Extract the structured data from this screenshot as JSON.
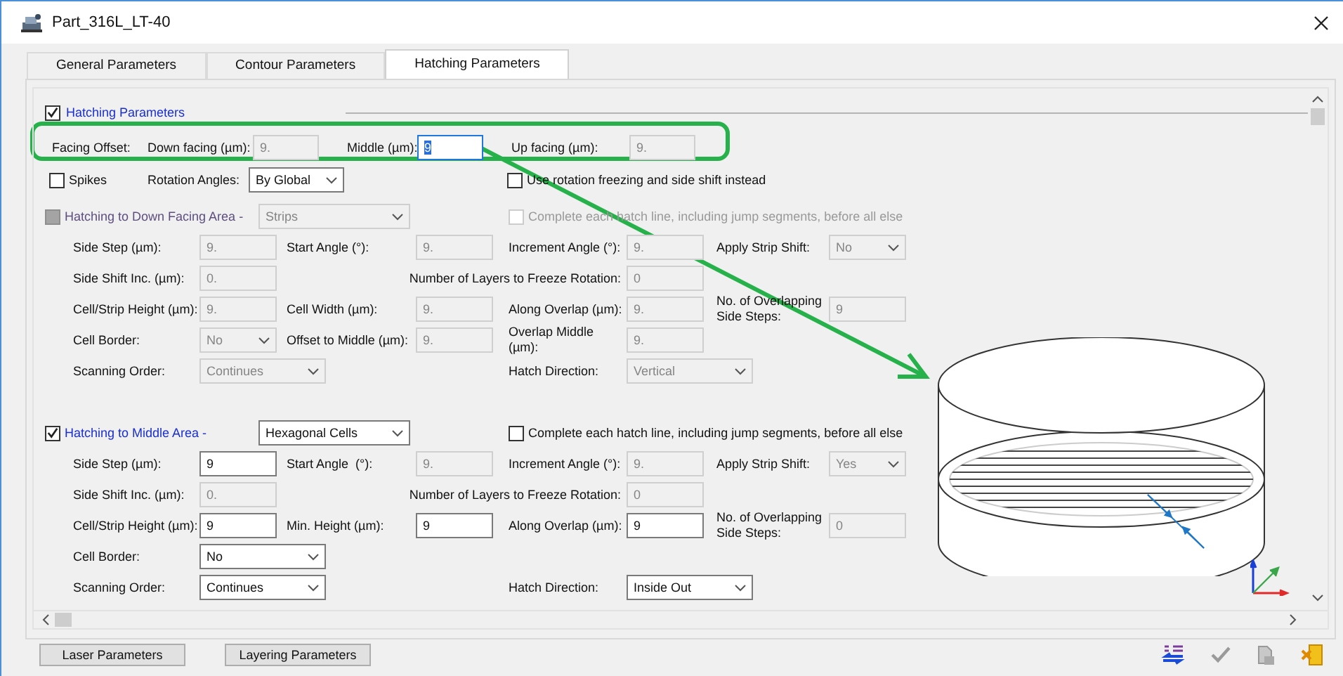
{
  "window": {
    "title": "Part_316L_LT-40"
  },
  "tabs": [
    {
      "label": "General Parameters",
      "selected": false
    },
    {
      "label": "Contour Parameters",
      "selected": false
    },
    {
      "label": "Hatching Parameters",
      "selected": true
    }
  ],
  "hatching_parameters": {
    "label": "Hatching Parameters",
    "checked": true
  },
  "facing_offset": {
    "label": "Facing Offset:",
    "fields": [
      {
        "label": "Down facing (µm):",
        "value": "9.",
        "disabled": true,
        "focused": false
      },
      {
        "label": "Middle (µm):",
        "value": "9",
        "disabled": false,
        "focused": true
      },
      {
        "label": "Up facing (µm):",
        "value": "9.",
        "disabled": true,
        "focused": false
      }
    ]
  },
  "options": {
    "spikes": {
      "label": "Spikes",
      "checked": false
    },
    "rotation_angles": {
      "label": "Rotation Angles:",
      "value": "By Global"
    },
    "rotation_freezing": {
      "label": "Use rotation freezing and side shift instead",
      "checked": false
    }
  },
  "areas": [
    {
      "label": "Hatching to Down Facing Area -",
      "checked": false,
      "disabled": true,
      "pattern": "Strips",
      "complete": {
        "label": "Complete each hatch line, including jump segments, before all else",
        "checked": false
      },
      "rows": [
        [
          {
            "label": "Side Step (µm):",
            "kind": "input",
            "value": "9.",
            "disabled": true
          },
          {
            "label": "Start Angle (°):",
            "kind": "input",
            "value": "9.",
            "disabled": true
          },
          {
            "label": "Increment Angle (°):",
            "kind": "input",
            "value": "9.",
            "disabled": true
          },
          {
            "label": "Apply Strip Shift:",
            "kind": "select",
            "value": "No",
            "disabled": true
          }
        ],
        [
          {
            "label": "Side Shift Inc. (µm):",
            "kind": "input",
            "value": "0.",
            "disabled": true
          },
          null,
          {
            "label": "Number of Layers to Freeze Rotation:",
            "kind": "input",
            "value": "0",
            "disabled": true
          },
          null
        ],
        [
          {
            "label": "Cell/Strip Height (µm):",
            "kind": "input",
            "value": "9.",
            "disabled": true
          },
          {
            "label": "Cell Width (µm):",
            "kind": "input",
            "value": "9.",
            "disabled": true
          },
          {
            "label": "Along Overlap (µm):",
            "kind": "input",
            "value": "9.",
            "disabled": true
          },
          {
            "label": "No. of Overlapping Side Steps:",
            "kind": "input",
            "value": "9",
            "disabled": true
          }
        ],
        [
          {
            "label": "Cell Border:",
            "kind": "select",
            "value": "No",
            "disabled": true
          },
          {
            "label": "Offset to Middle (µm):",
            "kind": "input",
            "value": "9.",
            "disabled": true
          },
          {
            "label": "Overlap Middle (µm):",
            "kind": "input",
            "value": "9.",
            "disabled": true
          },
          null
        ],
        [
          {
            "label": "Scanning Order:",
            "kind": "select",
            "value": "Continues",
            "disabled": true
          },
          null,
          {
            "label": "Hatch Direction:",
            "kind": "select",
            "value": "Vertical",
            "disabled": true
          },
          null
        ]
      ]
    },
    {
      "label": "Hatching to Middle Area -",
      "checked": true,
      "disabled": false,
      "pattern": "Hexagonal Cells",
      "complete": {
        "label": "Complete each hatch line, including jump segments, before all else",
        "checked": false
      },
      "rows": [
        [
          {
            "label": "Side Step (µm):",
            "kind": "input",
            "value": "9",
            "disabled": false
          },
          {
            "label": "Start Angle  (°):",
            "kind": "input",
            "value": "9.",
            "disabled": true
          },
          {
            "label": "Increment Angle (°):",
            "kind": "input",
            "value": "9.",
            "disabled": true
          },
          {
            "label": "Apply Strip Shift:",
            "kind": "select",
            "value": "Yes",
            "disabled": true
          }
        ],
        [
          {
            "label": "Side Shift Inc. (µm):",
            "kind": "input",
            "value": "0.",
            "disabled": true
          },
          null,
          {
            "label": "Number of Layers to Freeze Rotation:",
            "kind": "input",
            "value": "0",
            "disabled": true
          },
          null
        ],
        [
          {
            "label": "Cell/Strip Height (µm):",
            "kind": "input",
            "value": "9",
            "disabled": false
          },
          {
            "label": "Min. Height (µm):",
            "kind": "input",
            "value": "9",
            "disabled": false
          },
          {
            "label": "Along Overlap (µm):",
            "kind": "input",
            "value": "9",
            "disabled": false
          },
          {
            "label": "No. of Overlapping Side Steps:",
            "kind": "input",
            "value": "0",
            "disabled": true
          }
        ],
        [
          {
            "label": "Cell Border:",
            "kind": "select",
            "value": "No",
            "disabled": false
          },
          null,
          null,
          null
        ],
        [
          {
            "label": "Scanning Order:",
            "kind": "select",
            "value": "Continues",
            "disabled": false
          },
          null,
          {
            "label": "Hatch Direction:",
            "kind": "select",
            "value": "Inside Out",
            "disabled": false
          },
          null
        ]
      ]
    }
  ],
  "buttons": [
    "Laser Parameters",
    "Layering Parameters"
  ]
}
